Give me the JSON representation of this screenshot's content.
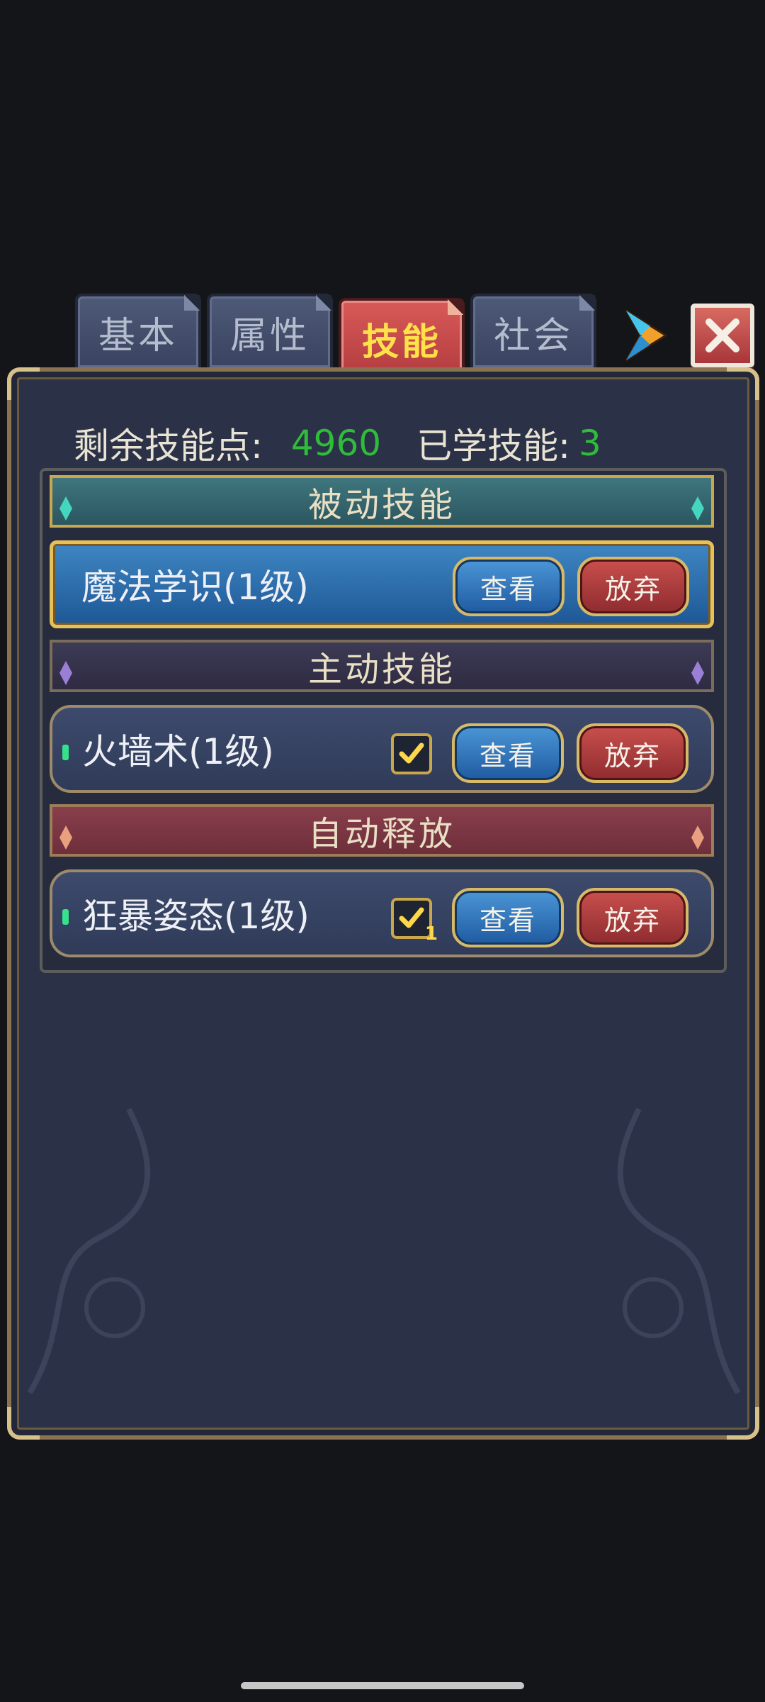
{
  "tabs": [
    {
      "label": "基本",
      "active": false
    },
    {
      "label": "属性",
      "active": false
    },
    {
      "label": "技能",
      "active": true
    },
    {
      "label": "社会",
      "active": false
    }
  ],
  "stats": {
    "remaining_label": "剩余技能点:",
    "remaining_value": "4960",
    "learned_label": "已学技能:",
    "learned_value": "3"
  },
  "sections": {
    "passive": {
      "title": "被动技能",
      "skills": [
        {
          "name": "魔法学识(1级)",
          "selected": true
        }
      ]
    },
    "active": {
      "title": "主动技能",
      "skills": [
        {
          "name": "火墙术(1级)",
          "checked": true
        }
      ]
    },
    "auto": {
      "title": "自动释放",
      "skills": [
        {
          "name": "狂暴姿态(1级)",
          "checked": true,
          "count": "1"
        }
      ]
    }
  },
  "buttons": {
    "view_label": "查看",
    "drop_label": "放弃"
  },
  "colors": {
    "accent_green": "#2fbc3a",
    "tab_active_text": "#ffe14a",
    "passive_header": "#3f767e",
    "active_header": "#3d3a55",
    "auto_header": "#8a3e4c"
  },
  "icons": {
    "next": "arrow-right-icon",
    "close": "close-icon",
    "check": "checkmark-icon"
  }
}
